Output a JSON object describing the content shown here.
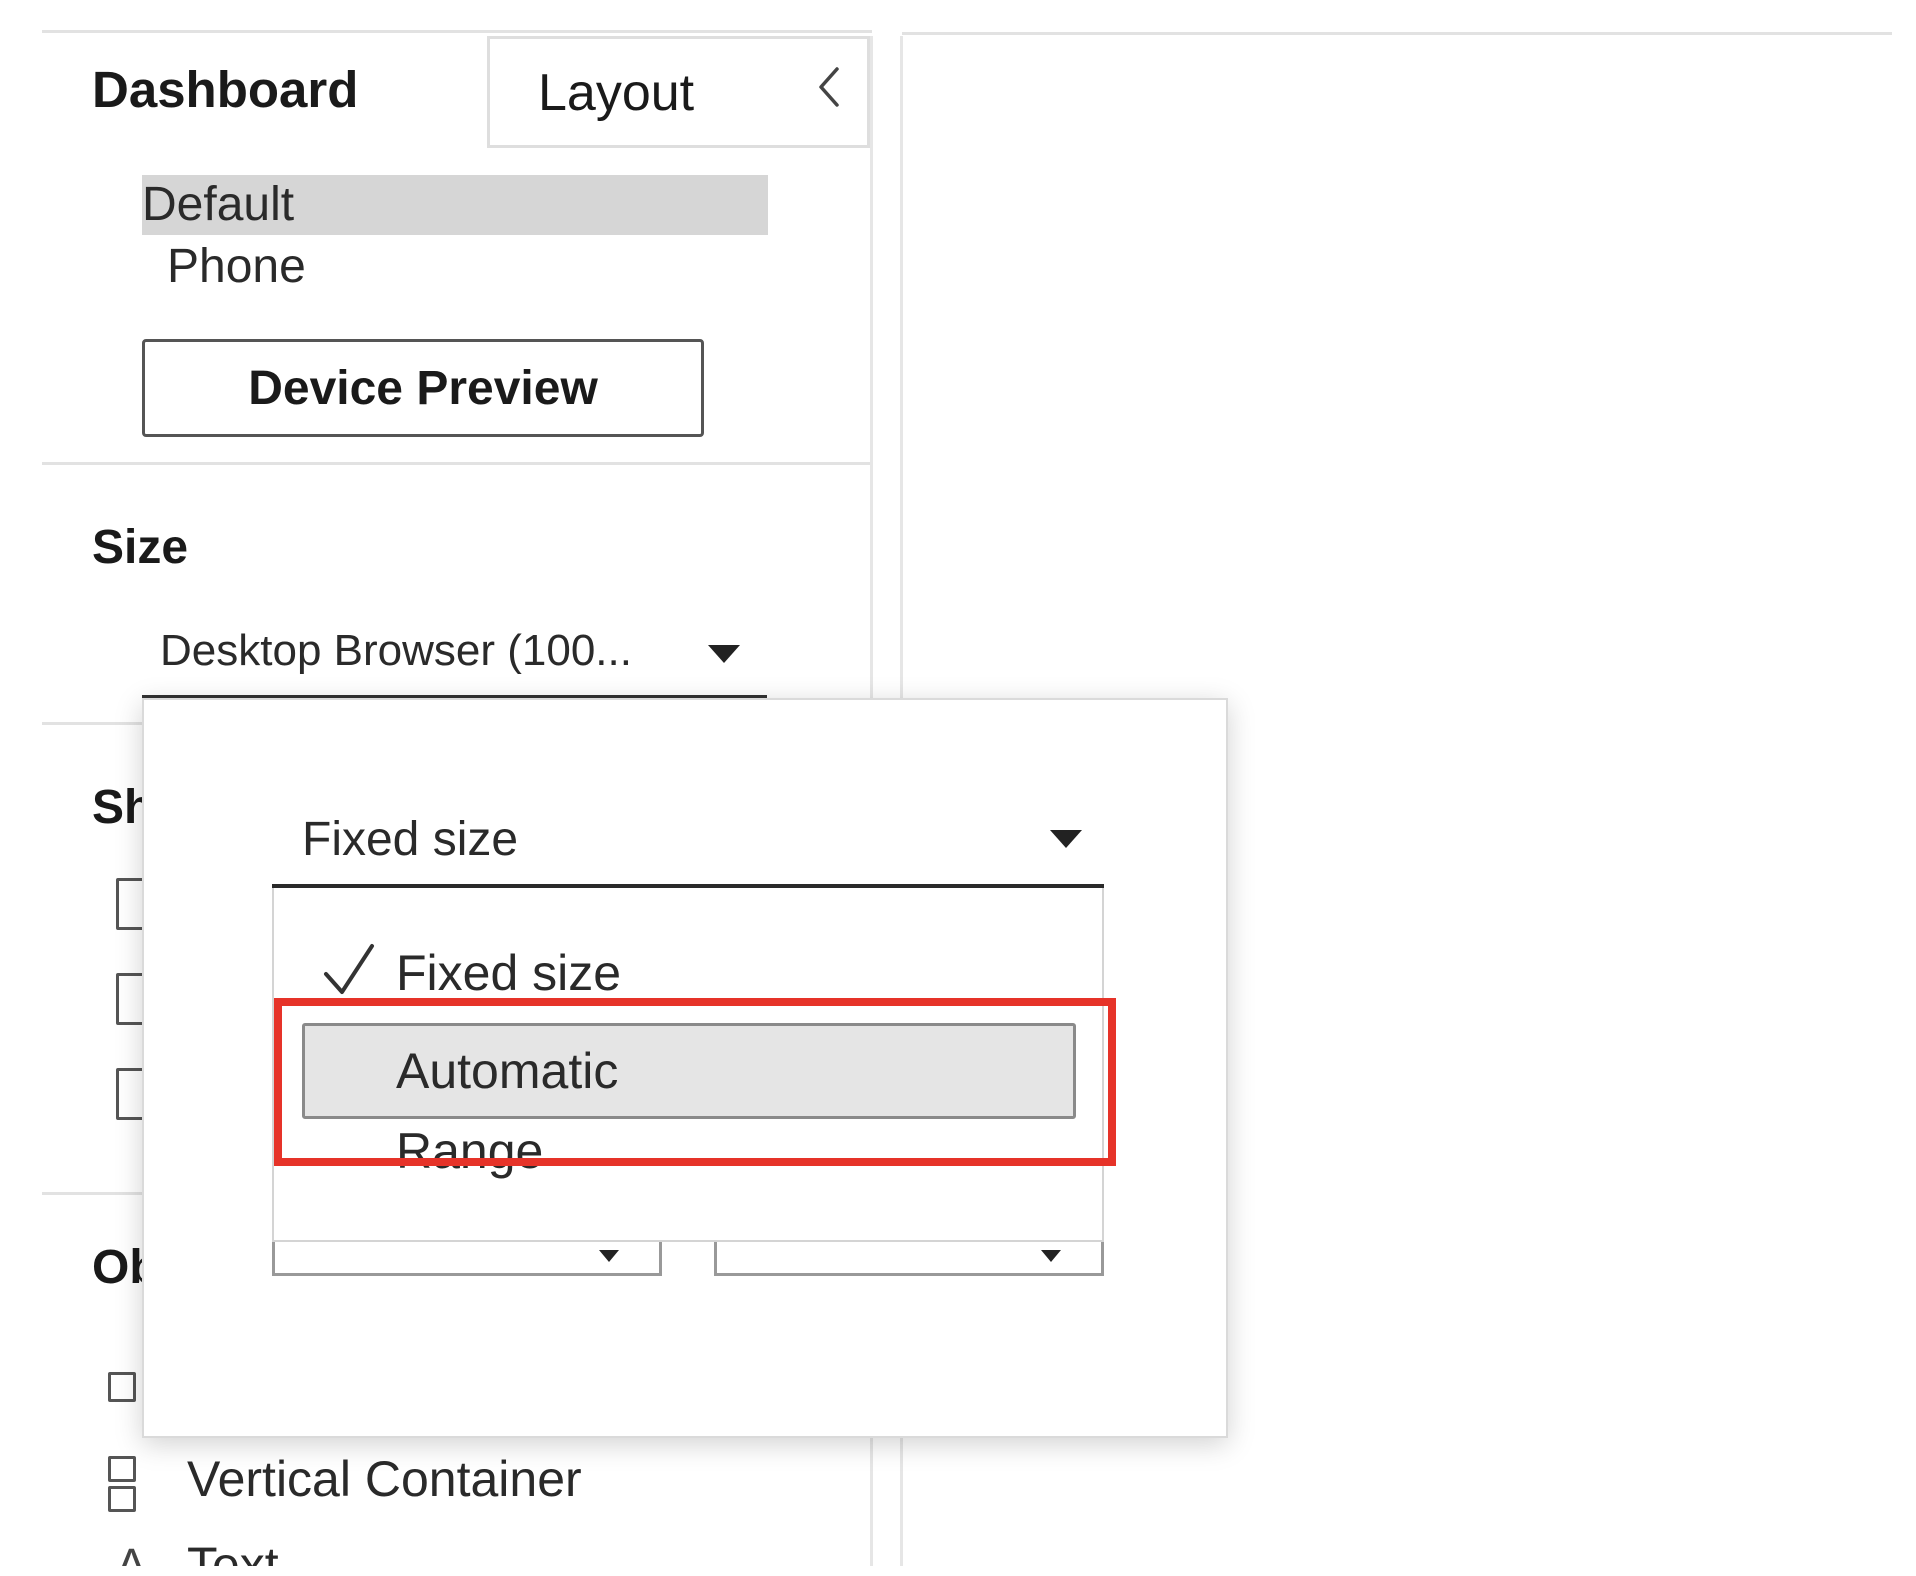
{
  "tabs": {
    "dashboard_label": "Dashboard",
    "layout_label": "Layout",
    "collapse_icon": "chevron-left-icon"
  },
  "layout_list": {
    "items": [
      {
        "label": "Default",
        "selected": true
      },
      {
        "label": "Phone",
        "selected": false
      }
    ]
  },
  "device_preview_label": "Device Preview",
  "size": {
    "title": "Size",
    "current_value": "Desktop Browser (100..."
  },
  "sheets": {
    "title_partial": "Sh"
  },
  "objects": {
    "title_partial": "Ob",
    "vertical_container_label": "Vertical Container",
    "text_label_partial": "Text"
  },
  "size_popup": {
    "mode_value": "Fixed size",
    "options": [
      {
        "label": "Fixed size",
        "checked": true,
        "hover": false
      },
      {
        "label": "Automatic",
        "checked": false,
        "hover": true
      },
      {
        "label": "Range",
        "checked": false,
        "hover": false
      }
    ]
  },
  "colors": {
    "highlight": "#e63329",
    "selected_bg": "#d6d6d6",
    "hover_bg": "#e5e5e5"
  }
}
